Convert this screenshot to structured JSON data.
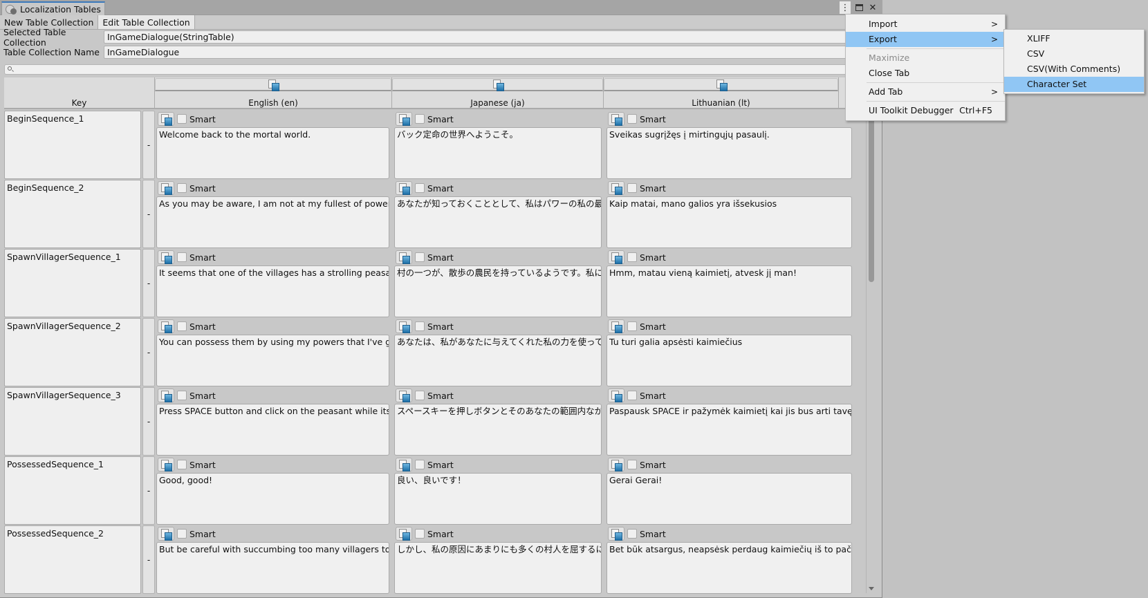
{
  "window": {
    "title": "Localization Tables",
    "controls": {
      "menu_icon": "kebab-icon",
      "maximize_icon": "maximize-icon",
      "close_icon": "close-icon",
      "close_glyph": "✕",
      "kebab_glyph": "⋮"
    }
  },
  "toolbar": {
    "tabs": [
      {
        "label": "New Table Collection",
        "active": false
      },
      {
        "label": "Edit Table Collection",
        "active": true
      }
    ]
  },
  "fields": {
    "selected_collection_label": "Selected Table Collection",
    "selected_collection_value": "InGameDialogue(StringTable)",
    "collection_name_label": "Table Collection Name",
    "collection_name_value": "InGameDialogue"
  },
  "search": {
    "value": "",
    "icon": "search-icon"
  },
  "table": {
    "key_header": "Key",
    "languages": [
      {
        "label": "English (en)",
        "icon": "asset-icon"
      },
      {
        "label": "Japanese (ja)",
        "icon": "asset-icon"
      },
      {
        "label": "Lithuanian (lt)",
        "icon": "asset-icon"
      }
    ],
    "smart_label": "Smart",
    "remove_label": "-",
    "rows": [
      {
        "key": "BeginSequence_1",
        "values": [
          "Welcome back to the mortal world.",
          "バック定命の世界へようこそ。",
          "Sveikas sugrįžęs į mirtingųjų pasaulį."
        ]
      },
      {
        "key": "BeginSequence_2",
        "values": [
          "As you may be aware, I am not at my fullest of power.",
          "あなたが知っておくこととして、私はパワーの私の最大限ではない",
          "Kaip matai, mano galios yra išsekusios"
        ]
      },
      {
        "key": "SpawnVillagerSequence_1",
        "values": [
          "It seems that one of the villages has a strolling peasant. Go b",
          "村の一つが、散歩の農民を持っているようです。私に彼を持って行",
          "Hmm, matau vieną kaimietį, atvesk jį man!"
        ]
      },
      {
        "key": "SpawnVillagerSequence_2",
        "values": [
          "You can possess them by using my powers that I've given to",
          "あなたは、私があなたに与えてくれた私の力を使って、それらを所有",
          "Tu turi galia apsėsti kaimiečius"
        ]
      },
      {
        "key": "SpawnVillagerSequence_3",
        "values": [
          "Press SPACE button and click on the peasant while its in yo",
          "スペースキーを押しボタンとそのあなたの範囲内ながら、農民をク",
          "Paspausk SPACE ir pažymėk kaimietį kai jis bus arti tavęs"
        ]
      },
      {
        "key": "PossessedSequence_1",
        "values": [
          "Good, good!",
          "良い、良いです！",
          "Gerai Gerai!"
        ]
      },
      {
        "key": "PossessedSequence_2",
        "values": [
          "But be careful with succumbing too many villagers to my ca",
          "しかし、私の原因にあまりにも多くの村人を屈するに注意してくだ",
          "Bet būk atsargus, neapsėsk perdaug kaimiečių iš to pačio kaim"
        ]
      }
    ]
  },
  "context_menu": {
    "items": [
      {
        "label": "Import",
        "submenu": true,
        "highlighted": false,
        "disabled": false
      },
      {
        "label": "Export",
        "submenu": true,
        "highlighted": true,
        "disabled": false
      },
      {
        "separator": true
      },
      {
        "label": "Maximize",
        "submenu": false,
        "highlighted": false,
        "disabled": true
      },
      {
        "label": "Close Tab",
        "submenu": false,
        "highlighted": false,
        "disabled": false
      },
      {
        "separator": true
      },
      {
        "label": "Add Tab",
        "submenu": true,
        "highlighted": false,
        "disabled": false
      },
      {
        "separator": true
      },
      {
        "label": "UI Toolkit Debugger",
        "shortcut": "Ctrl+F5",
        "submenu": false,
        "highlighted": false,
        "disabled": false
      }
    ],
    "arrow_glyph": ">"
  },
  "export_submenu": {
    "items": [
      {
        "label": "XLIFF",
        "highlighted": false
      },
      {
        "label": "CSV",
        "highlighted": false
      },
      {
        "label": "CSV(With Comments)",
        "highlighted": false
      },
      {
        "label": "Character Set",
        "highlighted": true
      }
    ]
  },
  "colors": {
    "menu_highlight": "#90c6f4",
    "tab_accent": "#3a79bb"
  }
}
